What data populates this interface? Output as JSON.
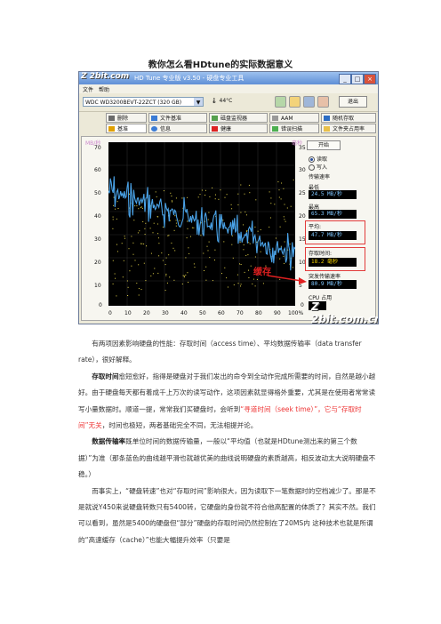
{
  "page_title": "教你怎么看HDtune的实际数据意义",
  "app": {
    "title": "HD Tune 专业版 v3.50 - 硬盘专业工具",
    "menu": [
      "文件",
      "帮助"
    ],
    "drive": "WDC WD3200BEVT-22ZCT (320 GB)",
    "temperature": "44°C",
    "exit_label": "退出",
    "tabs_row1": [
      "删除",
      "文件基准",
      "磁盘监视器",
      "AAM",
      "随机存取"
    ],
    "tabs_row2": [
      "基准",
      "信息",
      "健康",
      "错误扫描",
      "文件夹占用率"
    ],
    "y_axis_left": [
      "70",
      "60",
      "50",
      "40",
      "30",
      "20",
      "10",
      "0"
    ],
    "y_axis_left_unit": "MB/秒",
    "y_axis_right": [
      "35",
      "30",
      "25",
      "20",
      "15",
      "10",
      "5",
      "0"
    ],
    "y_axis_right_unit": "毫秒",
    "x_axis": [
      "0",
      "10",
      "20",
      "30",
      "40",
      "50",
      "60",
      "70",
      "80",
      "90",
      "100%"
    ],
    "start_label": "开始",
    "read_label": "读取",
    "write_label": "写入",
    "transfer_rate_label": "传输速率",
    "min_label": "最低",
    "min_value": "24.5 MB/秒",
    "max_label": "最高",
    "max_value": "65.3 MB/秒",
    "avg_label": "平均:",
    "avg_value": "47.7 MB/秒",
    "access_label": "存取时间:",
    "access_value": "18.2 毫秒",
    "burst_label": "突发传输速率",
    "burst_value": "80.9 MB/秒",
    "cpu_label": "CPU 占用",
    "cache_annotation": "缓存",
    "watermark_top": "Z 2bit.com",
    "watermark_bottom": "Z 2bit.com.cn"
  },
  "body": {
    "p1": "有两项因素影响硬盘的性能：存取时间（access time）、平均数据传输率（data transfer rate），很好解释。",
    "p2_bold": "存取时间",
    "p2a": "愈短愈好，指得是硬盘对于我们发出的命令到全动作完成所需要的时间，自然是越小越好。由于硬盘每天都有着成千上万次的读写动作，这项因素就显得格外重要，尤其是在使用者常常读写小量数据时。顺道一提，常常我们买硬盘时，会听到",
    "p2_red": "“寻道时间（seek time）”，它与“存取时间”无关",
    "p2b": "，时间也极短，两者基础完全不同，无法相提并论。",
    "p3_bold": "数据传输率",
    "p3a": "既单位时间的数据传输量，一般以“平均值（也就是HDtune测出来的第三个数据）”为准（那条蓝色的曲线越平滑也就越优美的曲线说明硬盘的素质越高，相反波动太大说明硬盘不稳。）",
    "p4": "而事实上，“硬盘转速”也对“存取时间”影响很大，因为读取下一笔数据时的空档减少了。那是不是就说Y450来说硬盘转数只有5400转，它硬盘的身份就不符合他高配置的体质了？其实不然。我们可以看到，虽然是5400的硬盘但“部分”硬盘的存取时间仍然控制在了20MS内 这种技术也就是所谓的“高速缓存（cache）”也能大幅提升效率（只要是"
  }
}
